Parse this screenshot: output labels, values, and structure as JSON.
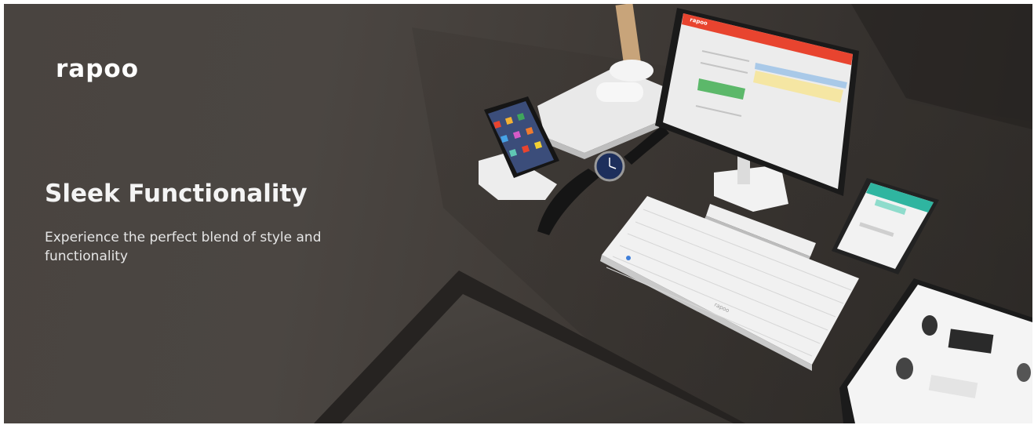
{
  "brand": {
    "logo_text": "rapoo"
  },
  "hero": {
    "headline": "Sleek Functionality",
    "subtitle": "Experience the perfect blend of style and functionality"
  },
  "photo": {
    "tablet_screen_text": "rapoo",
    "keyboard_brand": "rapoo"
  },
  "colors": {
    "background": "#494440",
    "text": "#ffffff",
    "accent": "#e8442f"
  }
}
